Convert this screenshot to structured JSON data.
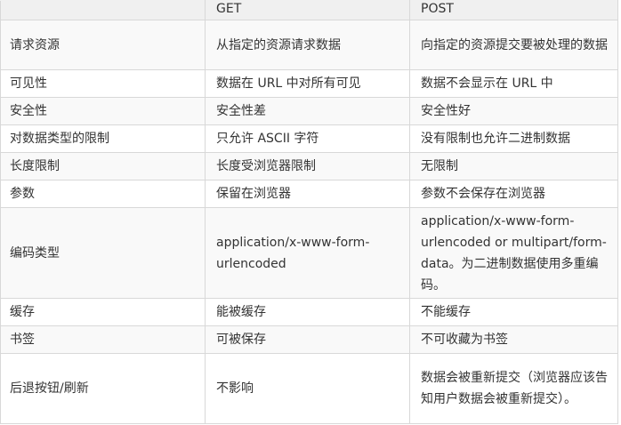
{
  "table": {
    "headers": [
      "",
      "GET",
      "POST"
    ],
    "rows": [
      {
        "label": "请求资源",
        "get": "从指定的资源请求数据",
        "post": "向指定的资源提交要被处理的数据"
      },
      {
        "label": "可见性",
        "get": "数据在 URL 中对所有可见",
        "post": "数据不会显示在 URL 中"
      },
      {
        "label": "安全性",
        "get": "安全性差",
        "post": "安全性好"
      },
      {
        "label": "对数据类型的限制",
        "get": "只允许 ASCII 字符",
        "post": "没有限制也允许二进制数据"
      },
      {
        "label": "长度限制",
        "get": "长度受浏览器限制",
        "post": "无限制"
      },
      {
        "label": "参数",
        "get": "保留在浏览器",
        "post": "参数不会保存在浏览器"
      },
      {
        "label": "编码类型",
        "get": "application/x-www-form-urlencoded",
        "post": "application/x-www-form-urlencoded or multipart/form-data。为二进制数据使用多重编码。"
      },
      {
        "label": "缓存",
        "get": "能被缓存",
        "post": "不能缓存"
      },
      {
        "label": "书签",
        "get": "可被保存",
        "post": "不可收藏为书签"
      },
      {
        "label": "后退按钮/刷新",
        "get": "不影响",
        "post": "数据会被重新提交（浏览器应该告知用户数据会被重新提交）。"
      }
    ]
  }
}
